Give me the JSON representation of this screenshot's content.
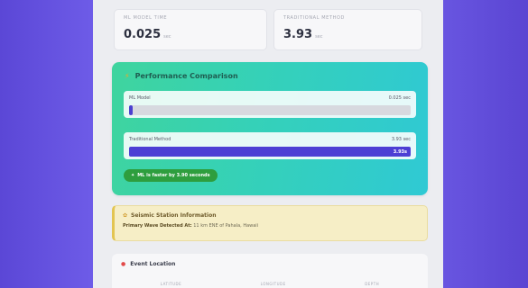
{
  "stats": {
    "ml": {
      "label": "ML Model Time",
      "value": "0.025",
      "unit": "sec"
    },
    "traditional": {
      "label": "Traditional Method",
      "value": "3.93",
      "unit": "sec"
    }
  },
  "performance": {
    "icon": "bolt-icon",
    "title": "Performance Comparison",
    "ml": {
      "label": "ML Model",
      "time": "0.025 sec",
      "fraction": 0.0064
    },
    "traditional": {
      "label": "Traditional Method",
      "time": "3.93 sec",
      "fill_label": "3.93s",
      "fraction": 1.0
    },
    "badge": "ML is faster by 3.90 seconds"
  },
  "seismic": {
    "icon": "leaf-icon",
    "title": "Seismic Station Information",
    "line_label": "Primary Wave Detected At:",
    "line_value": "11 km ENE of Pahala, Hawaii"
  },
  "event": {
    "icon": "pin-icon",
    "title": "Event Location",
    "columns": [
      "Latitude",
      "Longitude",
      "Depth"
    ]
  },
  "colors": {
    "background": "#6a57e2",
    "accent_bar": "#4c3fd4",
    "badge": "#2e9e3e",
    "seismic_bg": "#f6eec6"
  }
}
